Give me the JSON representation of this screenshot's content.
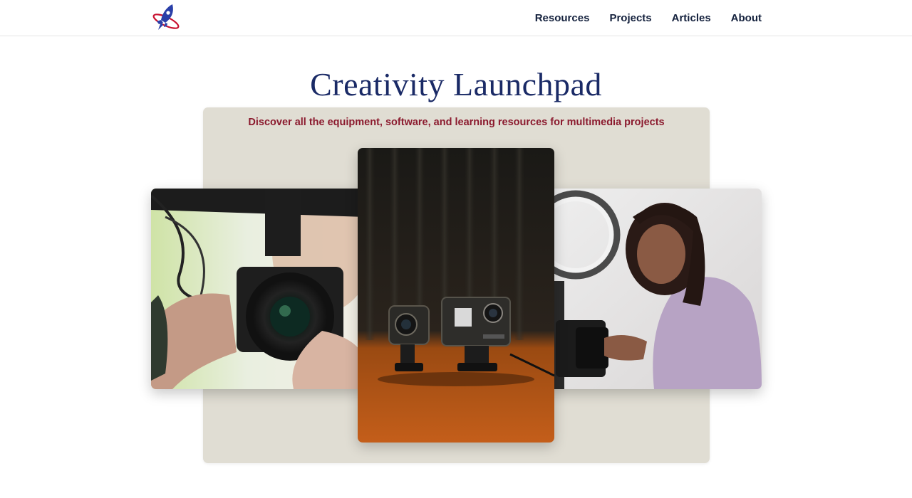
{
  "header": {
    "logo_icon": "rocket-icon",
    "nav": [
      {
        "label": "Resources"
      },
      {
        "label": "Projects"
      },
      {
        "label": "Articles"
      },
      {
        "label": "About"
      }
    ]
  },
  "hero": {
    "title": "Creativity Launchpad",
    "subtitle": "Discover all the equipment, software, and learning resources for multimedia projects"
  },
  "photos": [
    {
      "name": "video-camera-photo"
    },
    {
      "name": "action-cameras-photo"
    },
    {
      "name": "ring-light-photo"
    }
  ],
  "colors": {
    "title": "#1a2a66",
    "subtitle": "#8b1a2e",
    "nav_text": "#14213d",
    "panel": "#e0ddd3",
    "logo_blue": "#2a3fa8",
    "logo_red": "#c8102e"
  }
}
